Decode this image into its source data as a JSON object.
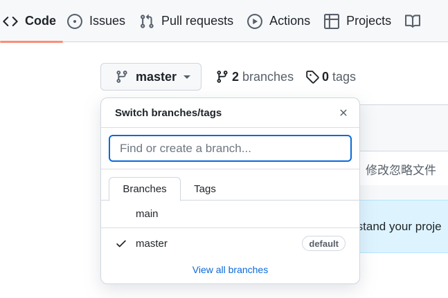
{
  "nav": {
    "tabs": [
      {
        "label": "Code",
        "icon": "code-icon",
        "active": true
      },
      {
        "label": "Issues",
        "icon": "issue-opened-icon"
      },
      {
        "label": "Pull requests",
        "icon": "git-pull-request-icon"
      },
      {
        "label": "Actions",
        "icon": "play-icon"
      },
      {
        "label": "Projects",
        "icon": "table-icon"
      },
      {
        "label": "",
        "icon": "book-icon"
      }
    ]
  },
  "toolbar": {
    "branch_label": "master",
    "branches_count": "2",
    "branches_label": "branches",
    "tags_count": "0",
    "tags_label": "tags"
  },
  "background": {
    "commit_message": "修改忽略文件",
    "info_text": "rstand your proje"
  },
  "dropdown": {
    "title": "Switch branches/tags",
    "search_placeholder": "Find or create a branch...",
    "tabs": {
      "branches": "Branches",
      "tags": "Tags"
    },
    "items": [
      {
        "label": "main",
        "selected": false
      },
      {
        "label": "master",
        "selected": true,
        "badge": "default"
      }
    ],
    "footer_link": "View all branches"
  },
  "colors": {
    "accent": "#0969da",
    "active_tab_underline": "#fd8c73",
    "info_bg": "#ddf4ff"
  }
}
